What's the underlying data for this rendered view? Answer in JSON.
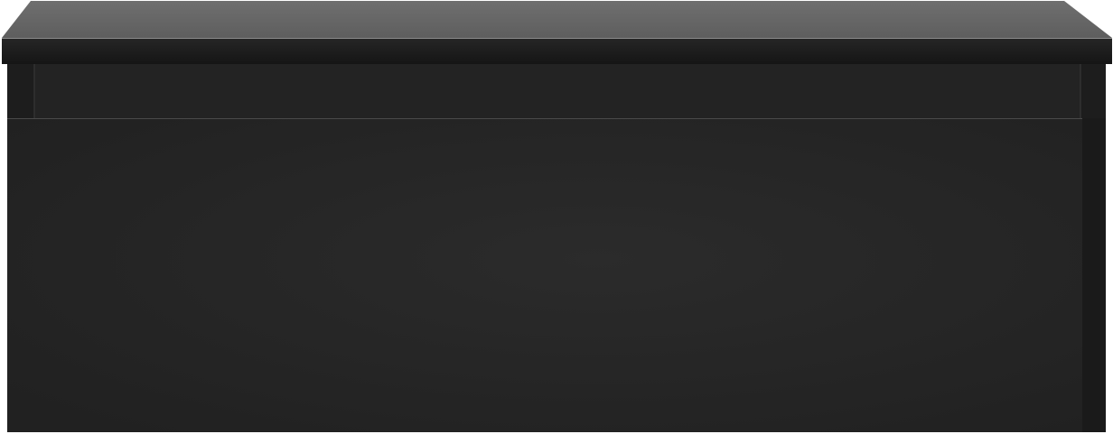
{
  "object": {
    "type": "wall-mounted drawer unit",
    "finish": "matte black",
    "colors": {
      "top_surface": "#6a6a6a",
      "top_edge": "#1c1c1c",
      "recess": "#1e1e1e",
      "drawer_front": "#272727",
      "drawer_front_shadow": "#1f1f1f",
      "seam": "#4a4a4a",
      "background": "#ffffff"
    }
  }
}
